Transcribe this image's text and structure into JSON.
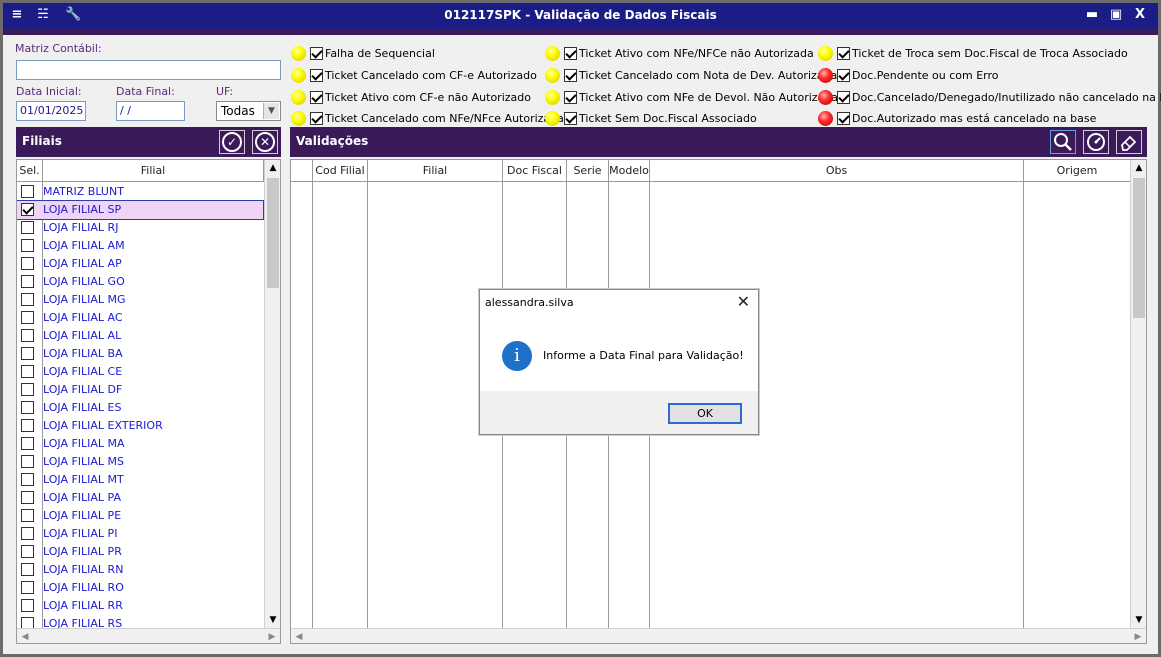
{
  "window": {
    "title": "012117SPK - Validação de Dados Fiscais",
    "minimize": "▬",
    "maximize": "▣",
    "close": "X"
  },
  "form": {
    "matriz_label": "Matriz Contábil:",
    "matriz_value": "",
    "data_inicial_label": "Data Inicial:",
    "data_inicial_value": "01/01/2025",
    "data_final_label": "Data Final:",
    "data_final_value": " / /",
    "uf_label": "UF:",
    "uf_value": "Todas"
  },
  "legend": [
    {
      "color": "yellow",
      "checked": true,
      "label": "Falha de Sequencial"
    },
    {
      "color": "yellow",
      "checked": true,
      "label": "Ticket Cancelado com CF-e Autorizado"
    },
    {
      "color": "yellow",
      "checked": true,
      "label": "Ticket Ativo com CF-e não Autorizado"
    },
    {
      "color": "yellow",
      "checked": true,
      "label": "Ticket Cancelado com NFe/NFce Autorizada"
    },
    {
      "color": "yellow",
      "checked": true,
      "label": "Ticket Ativo com NFe/NFCe não Autorizada"
    },
    {
      "color": "yellow",
      "checked": true,
      "label": "Ticket Cancelado com Nota de Dev. Autorizada"
    },
    {
      "color": "yellow",
      "checked": true,
      "label": "Ticket Ativo com NFe de Devol. Não Autorizada"
    },
    {
      "color": "yellow",
      "checked": true,
      "label": "Ticket Sem Doc.Fiscal Associado"
    },
    {
      "color": "yellow",
      "checked": true,
      "label": "Ticket de Troca sem Doc.Fiscal de Troca Associado"
    },
    {
      "color": "red",
      "checked": true,
      "label": "Doc.Pendente ou com Erro"
    },
    {
      "color": "red",
      "checked": true,
      "label": "Doc.Cancelado/Denegado/Inutilizado não cancelado na base"
    },
    {
      "color": "red",
      "checked": true,
      "label": "Doc.Autorizado mas está cancelado na base"
    }
  ],
  "filiais": {
    "title": "Filiais",
    "col_sel": "Sel.",
    "col_filial": "Filial",
    "rows": [
      {
        "name": "MATRIZ BLUNT",
        "checked": false
      },
      {
        "name": "LOJA FILIAL SP",
        "checked": true
      },
      {
        "name": "LOJA FILIAL RJ",
        "checked": false
      },
      {
        "name": "LOJA FILIAL AM",
        "checked": false
      },
      {
        "name": "LOJA FILIAL AP",
        "checked": false
      },
      {
        "name": "LOJA FILIAL GO",
        "checked": false
      },
      {
        "name": "LOJA FILIAL MG",
        "checked": false
      },
      {
        "name": "LOJA FILIAL AC",
        "checked": false
      },
      {
        "name": "LOJA FILIAL AL",
        "checked": false
      },
      {
        "name": "LOJA FILIAL BA",
        "checked": false
      },
      {
        "name": "LOJA FILIAL CE",
        "checked": false
      },
      {
        "name": "LOJA FILIAL DF",
        "checked": false
      },
      {
        "name": "LOJA FILIAL ES",
        "checked": false
      },
      {
        "name": "LOJA FILIAL EXTERIOR",
        "checked": false
      },
      {
        "name": "LOJA FILIAL MA",
        "checked": false
      },
      {
        "name": "LOJA FILIAL MS",
        "checked": false
      },
      {
        "name": "LOJA FILIAL MT",
        "checked": false
      },
      {
        "name": "LOJA FILIAL PA",
        "checked": false
      },
      {
        "name": "LOJA FILIAL PE",
        "checked": false
      },
      {
        "name": "LOJA FILIAL PI",
        "checked": false
      },
      {
        "name": "LOJA FILIAL PR",
        "checked": false
      },
      {
        "name": "LOJA FILIAL RN",
        "checked": false
      },
      {
        "name": "LOJA FILIAL RO",
        "checked": false
      },
      {
        "name": "LOJA FILIAL RR",
        "checked": false
      },
      {
        "name": "LOJA FILIAL RS",
        "checked": false
      }
    ]
  },
  "validacoes": {
    "title": "Validações",
    "columns": [
      "Cod Filial",
      "Filial",
      "Doc Fiscal",
      "Serie",
      "Modelo",
      "Obs",
      "Origem"
    ]
  },
  "dialog": {
    "title": "alessandra.silva",
    "message": "Informe a Data Final para Validação!",
    "ok_label": "OK",
    "close": "✕",
    "info_glyph": "i"
  },
  "colors": {
    "titlebar": "#1c1c86",
    "panel_header": "#3b1a5a",
    "link_text": "#1a1ad0",
    "selected_row": "#efd5f5"
  }
}
